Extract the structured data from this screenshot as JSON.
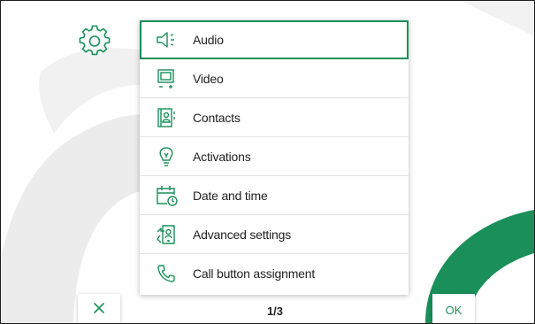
{
  "colors": {
    "accent": "#1a8f5a",
    "decor_gray": "#ececec"
  },
  "menu": {
    "items": [
      {
        "label": "Audio",
        "icon": "speaker-icon",
        "selected": true
      },
      {
        "label": "Video",
        "icon": "monitor-icon",
        "selected": false
      },
      {
        "label": "Contacts",
        "icon": "contacts-book-icon",
        "selected": false
      },
      {
        "label": "Activations",
        "icon": "lightbulb-icon",
        "selected": false
      },
      {
        "label": "Date and time",
        "icon": "calendar-clock-icon",
        "selected": false
      },
      {
        "label": "Advanced settings",
        "icon": "advanced-settings-icon",
        "selected": false
      },
      {
        "label": "Call button assignment",
        "icon": "phone-icon",
        "selected": false
      }
    ]
  },
  "footer": {
    "close_icon": "close-icon",
    "pager": "1/3",
    "ok_label": "OK"
  },
  "header": {
    "icon": "gear-icon"
  }
}
